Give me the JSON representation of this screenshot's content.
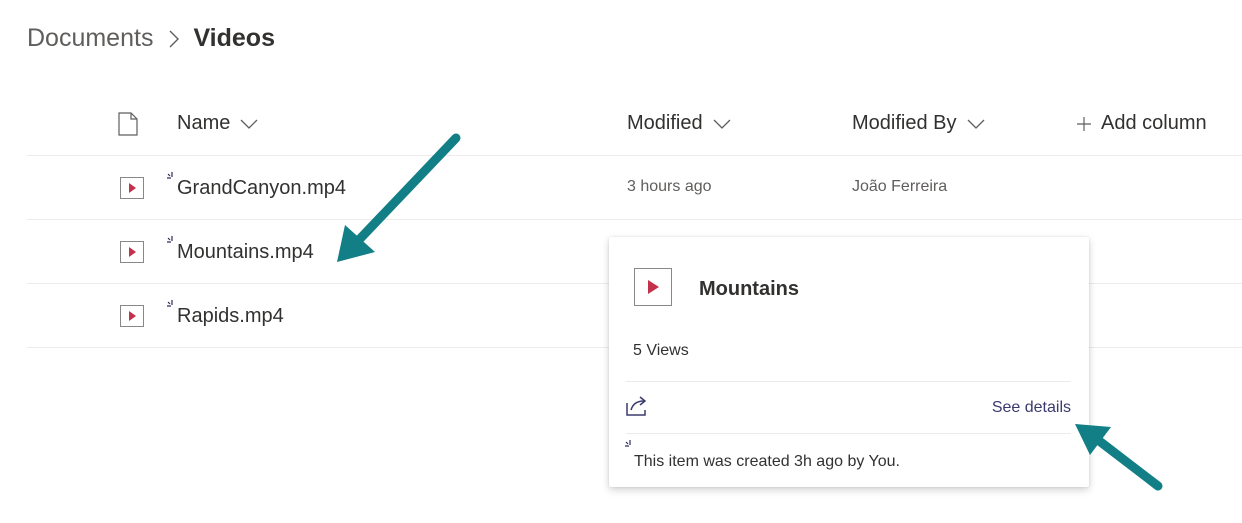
{
  "breadcrumb": {
    "root": "Documents",
    "current": "Videos"
  },
  "columns": {
    "name": "Name",
    "modified": "Modified",
    "modified_by": "Modified By",
    "add_column": "Add column"
  },
  "files": [
    {
      "name": "GrandCanyon.mp4",
      "modified": "3 hours ago",
      "modified_by": "João Ferreira"
    },
    {
      "name": "Mountains.mp4",
      "modified": "",
      "modified_by": ""
    },
    {
      "name": "Rapids.mp4",
      "modified": "",
      "modified_by": ""
    }
  ],
  "hover_card": {
    "title": "Mountains",
    "views": "5 Views",
    "see_details": "See details",
    "activity": "This item was created 3h ago by You."
  },
  "colors": {
    "accent_arrow": "#127f86",
    "video_icon": "#c4314b",
    "link": "#3b3a6e",
    "spinner": "#2b2a5c"
  },
  "icons": [
    "chevron-right-icon",
    "document-icon",
    "chevron-down-icon",
    "plus-icon",
    "video-file-icon",
    "loading-spinner-icon",
    "share-icon",
    "annotation-arrow"
  ]
}
